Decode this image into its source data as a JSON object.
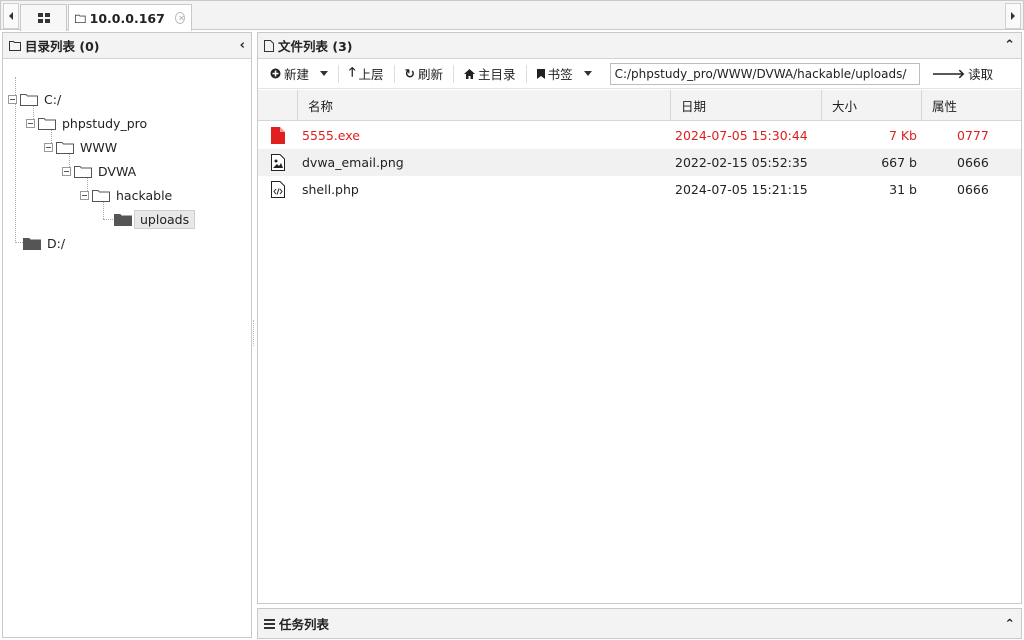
{
  "tabs": {
    "active_title": "10.0.0.167"
  },
  "dir_panel": {
    "title": "目录列表 (0)",
    "tree": [
      {
        "label": "C:/"
      },
      {
        "label": "phpstudy_pro"
      },
      {
        "label": "WWW"
      },
      {
        "label": "DVWA"
      },
      {
        "label": "hackable"
      },
      {
        "label": "uploads"
      },
      {
        "label": "D:/"
      }
    ]
  },
  "file_panel": {
    "title": "文件列表 (3)",
    "toolbar": {
      "new_label": "新建",
      "up_label": "上层",
      "refresh_label": "刷新",
      "home_label": "主目录",
      "bookmark_label": "书签",
      "path_value": "C:/phpstudy_pro/WWW/DVWA/hackable/uploads/",
      "read_label": "读取"
    },
    "columns": [
      "名称",
      "日期",
      "大小",
      "属性"
    ],
    "files": [
      {
        "name": "5555.exe",
        "date": "2024-07-05 15:30:44",
        "size": "7 Kb",
        "attr": "0777",
        "icon": "file-red-icon"
      },
      {
        "name": "dvwa_email.png",
        "date": "2022-02-15 05:52:35",
        "size": "667 b",
        "attr": "0666",
        "icon": "image-file-icon"
      },
      {
        "name": "shell.php",
        "date": "2024-07-05 15:21:15",
        "size": "31 b",
        "attr": "0666",
        "icon": "code-file-icon"
      }
    ]
  },
  "task_panel": {
    "title": "任务列表"
  },
  "colors": {
    "danger": "#e02020",
    "panel_header": "#f3f3f3",
    "border": "#c9c9c9"
  }
}
